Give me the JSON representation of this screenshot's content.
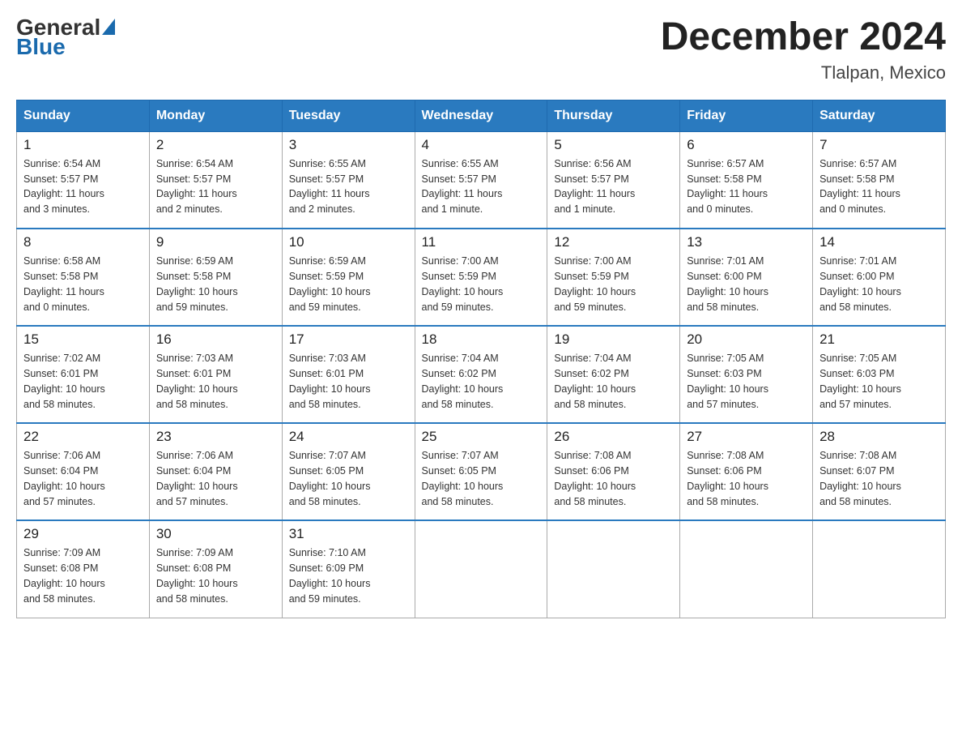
{
  "header": {
    "logo_text_general": "General",
    "logo_text_blue": "Blue",
    "title": "December 2024",
    "subtitle": "Tlalpan, Mexico"
  },
  "days_of_week": [
    "Sunday",
    "Monday",
    "Tuesday",
    "Wednesday",
    "Thursday",
    "Friday",
    "Saturday"
  ],
  "weeks": [
    [
      {
        "day": "1",
        "sunrise": "6:54 AM",
        "sunset": "5:57 PM",
        "daylight": "11 hours and 3 minutes."
      },
      {
        "day": "2",
        "sunrise": "6:54 AM",
        "sunset": "5:57 PM",
        "daylight": "11 hours and 2 minutes."
      },
      {
        "day": "3",
        "sunrise": "6:55 AM",
        "sunset": "5:57 PM",
        "daylight": "11 hours and 2 minutes."
      },
      {
        "day": "4",
        "sunrise": "6:55 AM",
        "sunset": "5:57 PM",
        "daylight": "11 hours and 1 minute."
      },
      {
        "day": "5",
        "sunrise": "6:56 AM",
        "sunset": "5:57 PM",
        "daylight": "11 hours and 1 minute."
      },
      {
        "day": "6",
        "sunrise": "6:57 AM",
        "sunset": "5:58 PM",
        "daylight": "11 hours and 0 minutes."
      },
      {
        "day": "7",
        "sunrise": "6:57 AM",
        "sunset": "5:58 PM",
        "daylight": "11 hours and 0 minutes."
      }
    ],
    [
      {
        "day": "8",
        "sunrise": "6:58 AM",
        "sunset": "5:58 PM",
        "daylight": "11 hours and 0 minutes."
      },
      {
        "day": "9",
        "sunrise": "6:59 AM",
        "sunset": "5:58 PM",
        "daylight": "10 hours and 59 minutes."
      },
      {
        "day": "10",
        "sunrise": "6:59 AM",
        "sunset": "5:59 PM",
        "daylight": "10 hours and 59 minutes."
      },
      {
        "day": "11",
        "sunrise": "7:00 AM",
        "sunset": "5:59 PM",
        "daylight": "10 hours and 59 minutes."
      },
      {
        "day": "12",
        "sunrise": "7:00 AM",
        "sunset": "5:59 PM",
        "daylight": "10 hours and 59 minutes."
      },
      {
        "day": "13",
        "sunrise": "7:01 AM",
        "sunset": "6:00 PM",
        "daylight": "10 hours and 58 minutes."
      },
      {
        "day": "14",
        "sunrise": "7:01 AM",
        "sunset": "6:00 PM",
        "daylight": "10 hours and 58 minutes."
      }
    ],
    [
      {
        "day": "15",
        "sunrise": "7:02 AM",
        "sunset": "6:01 PM",
        "daylight": "10 hours and 58 minutes."
      },
      {
        "day": "16",
        "sunrise": "7:03 AM",
        "sunset": "6:01 PM",
        "daylight": "10 hours and 58 minutes."
      },
      {
        "day": "17",
        "sunrise": "7:03 AM",
        "sunset": "6:01 PM",
        "daylight": "10 hours and 58 minutes."
      },
      {
        "day": "18",
        "sunrise": "7:04 AM",
        "sunset": "6:02 PM",
        "daylight": "10 hours and 58 minutes."
      },
      {
        "day": "19",
        "sunrise": "7:04 AM",
        "sunset": "6:02 PM",
        "daylight": "10 hours and 58 minutes."
      },
      {
        "day": "20",
        "sunrise": "7:05 AM",
        "sunset": "6:03 PM",
        "daylight": "10 hours and 57 minutes."
      },
      {
        "day": "21",
        "sunrise": "7:05 AM",
        "sunset": "6:03 PM",
        "daylight": "10 hours and 57 minutes."
      }
    ],
    [
      {
        "day": "22",
        "sunrise": "7:06 AM",
        "sunset": "6:04 PM",
        "daylight": "10 hours and 57 minutes."
      },
      {
        "day": "23",
        "sunrise": "7:06 AM",
        "sunset": "6:04 PM",
        "daylight": "10 hours and 57 minutes."
      },
      {
        "day": "24",
        "sunrise": "7:07 AM",
        "sunset": "6:05 PM",
        "daylight": "10 hours and 58 minutes."
      },
      {
        "day": "25",
        "sunrise": "7:07 AM",
        "sunset": "6:05 PM",
        "daylight": "10 hours and 58 minutes."
      },
      {
        "day": "26",
        "sunrise": "7:08 AM",
        "sunset": "6:06 PM",
        "daylight": "10 hours and 58 minutes."
      },
      {
        "day": "27",
        "sunrise": "7:08 AM",
        "sunset": "6:06 PM",
        "daylight": "10 hours and 58 minutes."
      },
      {
        "day": "28",
        "sunrise": "7:08 AM",
        "sunset": "6:07 PM",
        "daylight": "10 hours and 58 minutes."
      }
    ],
    [
      {
        "day": "29",
        "sunrise": "7:09 AM",
        "sunset": "6:08 PM",
        "daylight": "10 hours and 58 minutes."
      },
      {
        "day": "30",
        "sunrise": "7:09 AM",
        "sunset": "6:08 PM",
        "daylight": "10 hours and 58 minutes."
      },
      {
        "day": "31",
        "sunrise": "7:10 AM",
        "sunset": "6:09 PM",
        "daylight": "10 hours and 59 minutes."
      },
      null,
      null,
      null,
      null
    ]
  ]
}
